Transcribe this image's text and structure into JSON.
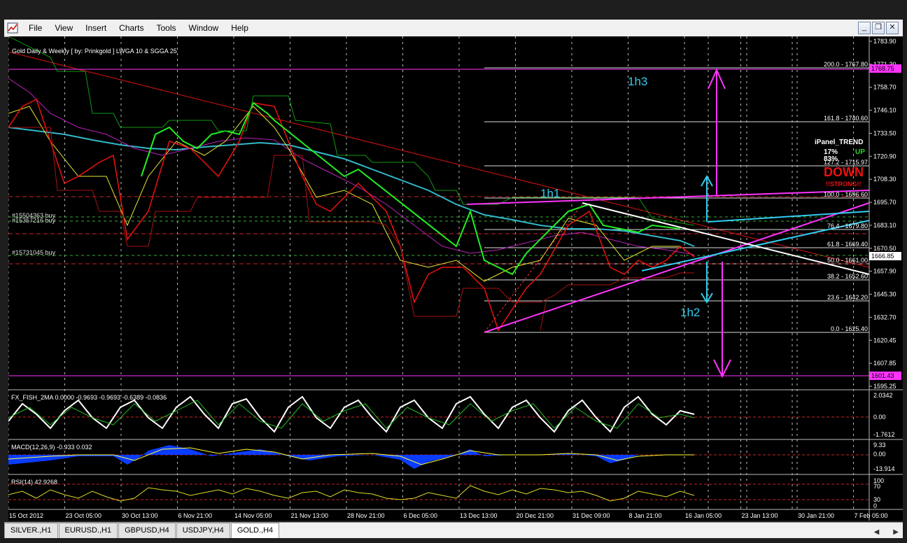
{
  "menu": [
    "File",
    "View",
    "Insert",
    "Charts",
    "Tools",
    "Window",
    "Help"
  ],
  "window_buttons": [
    "_",
    "❐",
    "✕"
  ],
  "chart": {
    "title": "Gold Daily & Weekly [ by: Prinkgold ] LWGA 10 & SGGA 25",
    "price_labels": [
      "1783.90",
      "1771.30",
      "1758.70",
      "1746.10",
      "1733.50",
      "1720.90",
      "1708.30",
      "1695.70",
      "1683.10",
      "1670.50",
      "1657.90",
      "1645.30",
      "1632.70",
      "1620.45",
      "1607.85",
      "1595.25"
    ],
    "highlight_top": "1768.75",
    "highlight_bottom": "1601.43",
    "current_price": "1666.85",
    "fib_levels": [
      "200.0 - 1767.80",
      "161.8 - 1740.60",
      "127.2 - 1715.97",
      "100.0 - 1696.60",
      "76.4 - 1679.80",
      "61.8 - 1669.40",
      "50.0 - 1661.00",
      "38.2 - 1652.60",
      "23.6 - 1642.20",
      "0.0 - 1625.40"
    ],
    "orders": [
      "#15504363 buy",
      "#15357216 buy",
      "#15731045 buy"
    ],
    "annotations": {
      "h1": "1h1",
      "h2": "1h2",
      "h3": "1h3"
    },
    "ipanel": {
      "title": "iPanel_TREND",
      "up_pct": "17%",
      "up_label": "UP",
      "down_pct": "83%",
      "down_label": "DOWN",
      "strong": "!!STRONG!!"
    },
    "time_labels": [
      "15 Oct 2012",
      "23 Oct 05:00",
      "30 Oct 13:00",
      "6 Nov 21:00",
      "14 Nov 05:00",
      "21 Nov 13:00",
      "28 Nov 21:00",
      "6 Dec 05:00",
      "13 Dec 13:00",
      "20 Dec 21:00",
      "31 Dec 09:00",
      "8 Jan 21:00",
      "16 Jan 05:00",
      "23 Jan 13:00",
      "30 Jan 21:00",
      "7 Feb 05:00"
    ]
  },
  "indicators": {
    "fisher": {
      "label": "FX_FISH_2MA 0.0000 -0.9693 -0.9693 -0.6389 -0.0836",
      "scale": [
        "2.0342",
        "0.00",
        "-1.7612"
      ]
    },
    "macd": {
      "label": "MACD(12,26,9) -0.933 0.032",
      "scale": [
        "9.33",
        "0.00",
        "-13.914"
      ]
    },
    "rsi": {
      "label": "RSI(14) 42.9268",
      "scale": [
        "100",
        "70",
        "30",
        "0"
      ]
    }
  },
  "tabs": [
    "SILVER.,H1",
    "EURUSD.,H1",
    "GBPUSD,H4",
    "USDJPY,H4",
    "GOLD.,H4"
  ],
  "active_tab": "GOLD.,H4",
  "colors": {
    "magenta": "#ff33ff",
    "cyan": "#33ccee",
    "green": "#22dd22",
    "red": "#ee1111",
    "grid": "#bbbbbb"
  }
}
